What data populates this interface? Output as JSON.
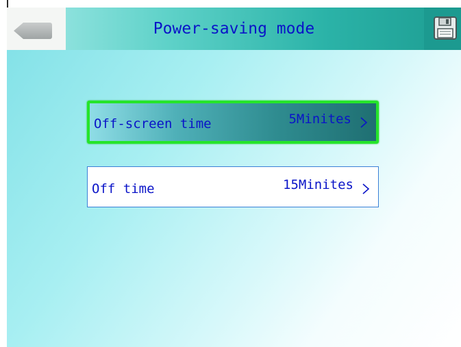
{
  "header": {
    "title": "Power-saving mode",
    "back_icon": "back-arrow-icon",
    "save_icon": "floppy-disk-icon"
  },
  "settings": [
    {
      "label": "Off-screen time",
      "value": "5Minites",
      "selected": true,
      "chevron_icon": "chevron-right-icon"
    },
    {
      "label": "Off time",
      "value": "15Minites",
      "selected": false,
      "chevron_icon": "chevron-right-icon"
    }
  ],
  "colors": {
    "text": "#0a14c8",
    "selection_border": "#25e52a",
    "header_accent": "#1d9d92"
  }
}
